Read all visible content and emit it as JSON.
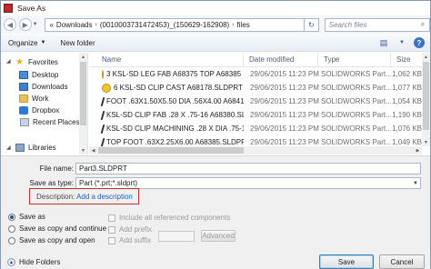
{
  "window": {
    "title": "Save As",
    "app_icon": "solidworks-app-icon"
  },
  "address_bar": {
    "back_icon": "back-arrow-icon",
    "forward_icon": "forward-arrow-icon",
    "recent_icon": "chevron-down-icon",
    "path": [
      "Downloads",
      "(0010003731472453)_(150629-162908)",
      "files"
    ],
    "root_marker": "«",
    "separator": "›",
    "refresh_icon": "refresh-icon",
    "search_placeholder": "Search files",
    "search_icon": "magnifier-icon"
  },
  "toolbar": {
    "organize_label": "Organize",
    "new_folder_label": "New folder",
    "view_icon": "view-options-icon",
    "help_label": "?"
  },
  "nav": {
    "items": [
      {
        "label": "Favorites",
        "icon": "star-icon",
        "expander": true
      },
      {
        "label": "Desktop",
        "icon": "desktop-icon"
      },
      {
        "label": "Downloads",
        "icon": "downloads-icon"
      },
      {
        "label": "Work",
        "icon": "folder-icon"
      },
      {
        "label": "Dropbox",
        "icon": "dropbox-icon"
      },
      {
        "label": "Recent Places",
        "icon": "recent-places-icon"
      },
      {
        "label": "Libraries",
        "icon": "libraries-icon",
        "expander": true
      }
    ]
  },
  "file_list": {
    "columns": [
      "Name",
      "Date modified",
      "Type",
      "Size"
    ],
    "rows": [
      {
        "name": "3 KSL-SD LEG FAB A68375 TOP A68385 F...",
        "date": "29/06/2015 11:23 PM",
        "type": "SOLIDWORKS Part...",
        "size": "1,062 KB",
        "icon": "assembly-icon"
      },
      {
        "name": "6 KSL-SD CLIP CAST A68178.SLDPRT",
        "date": "29/06/2015 11:23 PM",
        "type": "SOLIDWORKS Part...",
        "size": "1,077 KB",
        "icon": "assembly-icon"
      },
      {
        "name": "FOOT .63X1.50X5.50 DIA .56X4.00 A6841...",
        "date": "29/06/2015 11:23 PM",
        "type": "SOLIDWORKS Part...",
        "size": "1,054 KB",
        "icon": "part-icon"
      },
      {
        "name": "KSL-SD CLIP FAB .28 X .75-16 A68380.SL...",
        "date": "29/06/2015 11:23 PM",
        "type": "SOLIDWORKS Part...",
        "size": "1,190 KB",
        "icon": "part-icon"
      },
      {
        "name": "KSL-SD CLIP MACHINING .28 X DIA .75-1...",
        "date": "29/06/2015 11:23 PM",
        "type": "SOLIDWORKS Part...",
        "size": "1,076 KB",
        "icon": "part-icon"
      },
      {
        "name": "TOP FOOT .63X2.25X6.00 A68385.SLDPRT",
        "date": "29/06/2015 11:23 PM",
        "type": "SOLIDWORKS Part...",
        "size": "1,049 KB",
        "icon": "part-icon"
      }
    ]
  },
  "form": {
    "file_name_label": "File name:",
    "file_name_value": "Part3.SLDPRT",
    "save_type_label": "Save as type:",
    "save_type_value": "Part (*.prt;*.sldprt)",
    "description_label": "Description:",
    "description_link": "Add a description",
    "highlight_color": "#d22c2c"
  },
  "options": {
    "radios": [
      {
        "label": "Save as",
        "checked": true
      },
      {
        "label": "Save as copy and continue",
        "checked": false
      },
      {
        "label": "Save as copy and open",
        "checked": false
      }
    ],
    "include_refs_label": "Include all referenced components",
    "add_prefix_label": "Add prefix",
    "add_suffix_label": "Add suffix",
    "advanced_label": "Advanced"
  },
  "footer": {
    "hide_folders_label": "Hide Folders",
    "save_label": "Save",
    "cancel_label": "Cancel"
  }
}
